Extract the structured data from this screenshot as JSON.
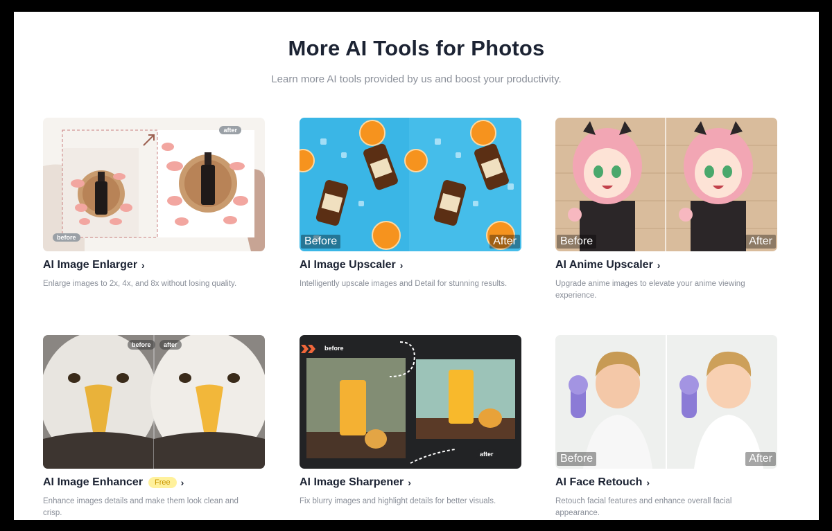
{
  "section": {
    "title": "More AI Tools for Photos",
    "subtitle": "Learn more AI tools provided by us and boost your productivity."
  },
  "cards": [
    {
      "title": "AI Image Enlarger",
      "description": "Enlarge images to 2x, 4x, and 8x without losing quality.",
      "labels": {
        "after": "after",
        "before": "before"
      }
    },
    {
      "title": "AI Image Upscaler",
      "description": "Intelligently upscale images and Detail for stunning results.",
      "labels": {
        "before": "Before",
        "after": "After"
      }
    },
    {
      "title": "AI Anime Upscaler",
      "description": "Upgrade anime images to elevate your anime viewing experience.",
      "labels": {
        "before": "Before",
        "after": "After"
      }
    },
    {
      "title": "AI Image Enhancer",
      "badge": "Free",
      "description": "Enhance images details and make them look clean and crisp.",
      "labels": {
        "before": "before",
        "after": "after"
      }
    },
    {
      "title": "AI Image Sharpener",
      "description": "Fix blurry images and highlight details for better visuals.",
      "labels": {
        "before": "before",
        "after": "after"
      }
    },
    {
      "title": "AI Face Retouch",
      "description": "Retouch facial features and enhance overall facial appearance.",
      "labels": {
        "before": "Before",
        "after": "After"
      }
    }
  ],
  "colors": {
    "title": "#1c2333",
    "muted": "#8a8f99",
    "badge_bg": "#fff19c",
    "badge_text": "#c99500",
    "upscaler_bg": "#3ab6e6"
  },
  "icons": [
    "chevron-right-icon",
    "arrow-enlarge-icon",
    "double-chevron-icon"
  ]
}
